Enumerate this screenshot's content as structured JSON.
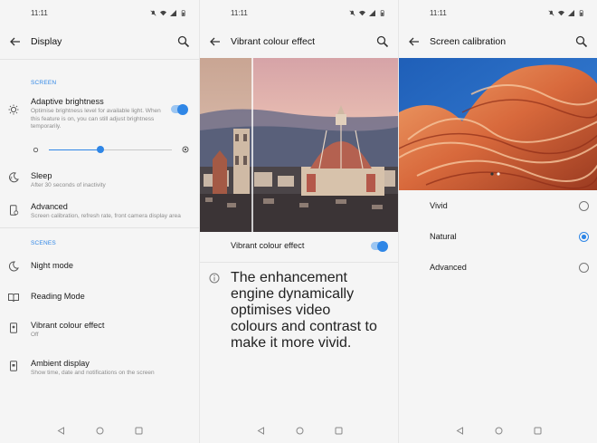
{
  "screens": [
    {
      "status": {
        "time": "11:11"
      },
      "appbar": {
        "title": "Display"
      },
      "sections": {
        "screen": "SCREEN",
        "scenes": "SCENES"
      },
      "adaptive": {
        "title": "Adaptive brightness",
        "sub": "Optimise brightness level for available light. When this feature is on, you can still adjust brightness temporarily.",
        "toggle_on": true,
        "brightness_level": 0.42
      },
      "sleep": {
        "title": "Sleep",
        "sub": "After 30 seconds of inactivity"
      },
      "advanced": {
        "title": "Advanced",
        "sub": "Screen calibration, refresh rate, front camera display area"
      },
      "night": {
        "title": "Night mode"
      },
      "reading": {
        "title": "Reading Mode"
      },
      "vibrant": {
        "title": "Vibrant colour effect",
        "sub": "Off"
      },
      "ambient": {
        "title": "Ambient display",
        "sub": "Show time, date and notifications on the screen"
      }
    },
    {
      "status": {
        "time": "11:11"
      },
      "appbar": {
        "title": "Vibrant colour effect"
      },
      "toggle_row": {
        "title": "Vibrant colour effect",
        "toggle_on": true
      },
      "info": {
        "text": "The enhancement engine dynamically optimises video colours and contrast to make it more vivid."
      }
    },
    {
      "status": {
        "time": "11:11"
      },
      "appbar": {
        "title": "Screen calibration"
      },
      "options": [
        {
          "label": "Vivid",
          "selected": false
        },
        {
          "label": "Natural",
          "selected": true
        },
        {
          "label": "Advanced",
          "selected": false
        }
      ]
    }
  ],
  "colors": {
    "accent": "#2f86e6",
    "text": "#1a1a1a",
    "subtext": "#8c8c8c"
  },
  "icons": [
    "back-arrow-icon",
    "search-icon",
    "brightness-icon",
    "sleep-icon",
    "advanced-icon",
    "night-mode-icon",
    "reading-mode-icon",
    "vibrant-icon",
    "ambient-icon",
    "info-icon",
    "wifi-icon",
    "battery-icon",
    "mute-icon",
    "signal-icon"
  ]
}
